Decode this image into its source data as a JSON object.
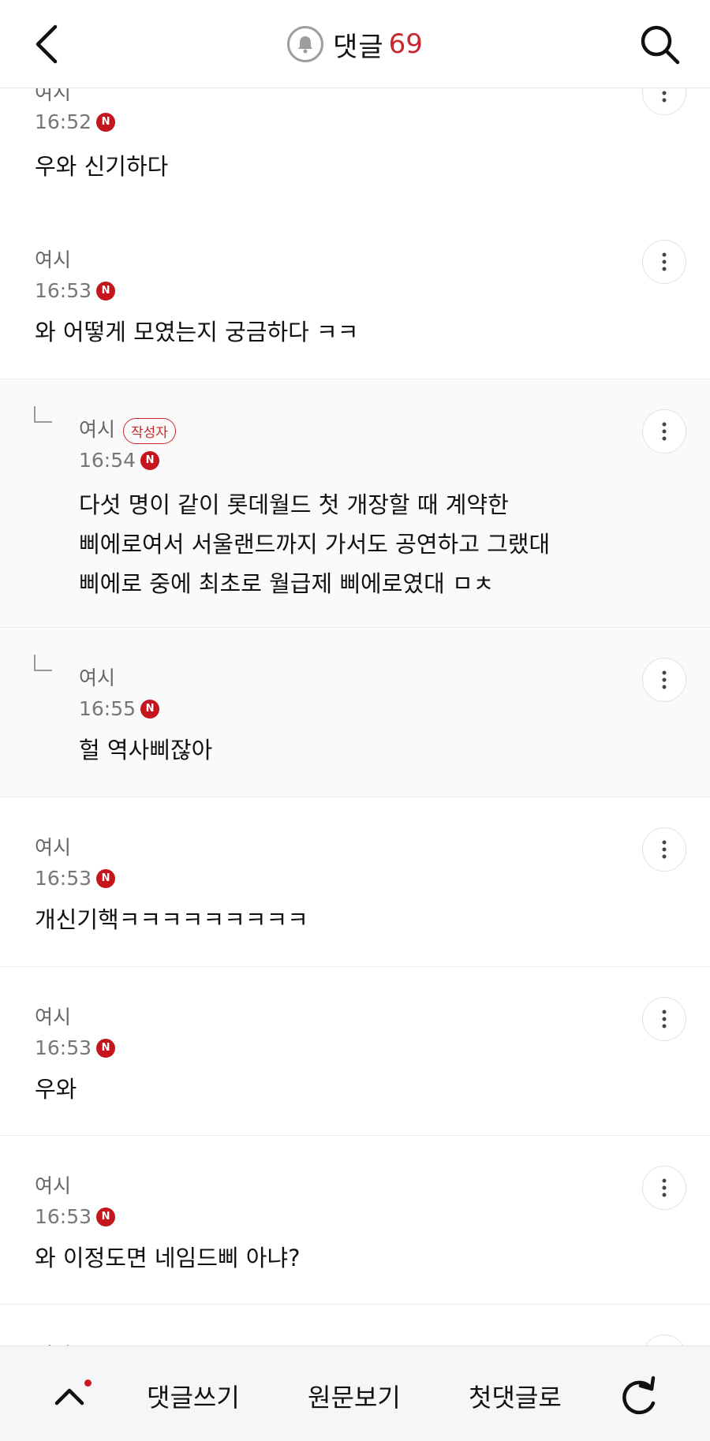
{
  "header": {
    "title": "댓글",
    "count": "69",
    "accent_color": "#c8282d"
  },
  "comments": [
    {
      "author": "여시",
      "time": "16:52",
      "text": "우와 신기하다"
    },
    {
      "author": "여시",
      "time": "16:53",
      "text": "와 어떻게 모였는지 궁금하다 ㅋㅋ"
    },
    {
      "author": "여시",
      "badge": "작성자",
      "time": "16:54",
      "lines": [
        "다섯 명이 같이 롯데월드 첫 개장할 때 계약한",
        "삐에로여서 서울랜드까지 가서도 공연하고 그랬대",
        "삐에로 중에 최초로 월급제 삐에로였대 ㅁㅊ"
      ]
    },
    {
      "author": "여시",
      "time": "16:55",
      "text": "헐 역사삐잖아"
    },
    {
      "author": "여시",
      "time": "16:53",
      "text": "개신기핵ㅋㅋㅋㅋㅋㅋㅋㅋㅋ"
    },
    {
      "author": "여시",
      "time": "16:53",
      "text": "우와"
    },
    {
      "author": "여시",
      "time": "16:53",
      "text": "와 이정도면 네임드삐 아냐?"
    },
    {
      "author": "여시"
    }
  ],
  "new_badge": "N",
  "bottom_bar": {
    "write": "댓글쓰기",
    "original": "원문보기",
    "first": "첫댓글로"
  },
  "icons": {
    "back": "chevron-left-icon",
    "bell": "bell-icon",
    "search": "search-icon",
    "more": "more-vertical-icon",
    "reply": "reply-corner-icon",
    "up": "chevron-up-icon",
    "refresh": "refresh-icon"
  }
}
